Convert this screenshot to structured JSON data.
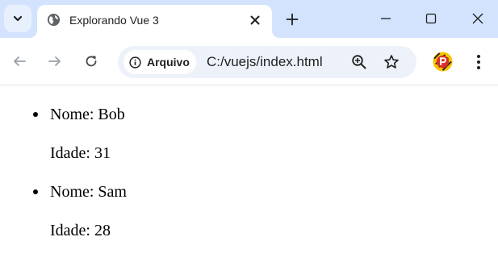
{
  "browser": {
    "tab": {
      "title": "Explorando Vue 3"
    },
    "site_chip_label": "Arquivo",
    "url": "C:/vuejs/index.html",
    "icons": {
      "tab_search": "chevron-down-icon",
      "favicon": "globe-icon",
      "tab_close": "close-icon",
      "new_tab": "plus-icon",
      "minimize": "minimize-icon",
      "maximize": "maximize-icon",
      "close_window": "close-icon",
      "back": "back-arrow-icon",
      "forward": "forward-arrow-icon",
      "reload": "reload-icon",
      "info": "info-icon",
      "zoom": "zoom-in-icon",
      "bookmark": "star-icon",
      "profile": "profile-avatar-icon",
      "menu": "kebab-menu-icon"
    },
    "colors": {
      "tabstrip": "#d3e3fd",
      "omnibox": "#edf2fa",
      "profile_red": "#d93025",
      "profile_yellow": "#f9c300"
    }
  },
  "people": [
    {
      "name_line": "Nome: Bob",
      "age_line": "Idade: 31"
    },
    {
      "name_line": "Nome: Sam",
      "age_line": "Idade: 28"
    }
  ]
}
